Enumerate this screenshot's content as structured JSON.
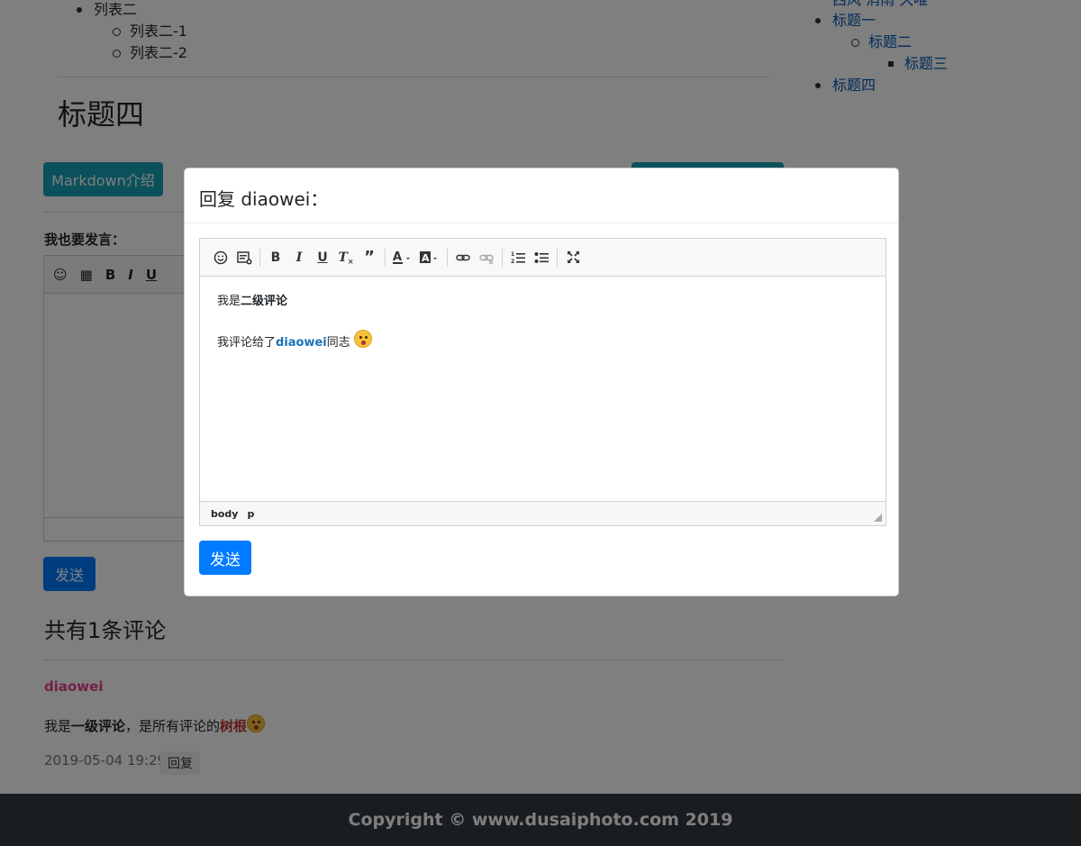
{
  "content_list": {
    "item2": "列表二",
    "sub1": "列表二-1",
    "sub2": "列表二-2"
  },
  "heading": "标题四",
  "toc": {
    "top": "西风 消雨 久唯",
    "item1": "标题一",
    "item2": "标题二",
    "item3": "标题三",
    "item4": "标题四"
  },
  "markdown_button": "Markdown介绍",
  "comment_form": {
    "label": "我也要发言：",
    "send_label": "发送"
  },
  "comments": {
    "title": "共有1条评论",
    "author": "diaowei",
    "body_prefix": "我是",
    "body_bold": "一级评论",
    "body_middle": "，是所有评论的",
    "body_highlight": "树根",
    "time": "2019-05-04 19:29",
    "reply_label": "回复"
  },
  "footer": "Copyright © www.dusaiphoto.com 2019",
  "modal": {
    "title": "回复 diaowei：",
    "line1_prefix": "我是",
    "line1_bold": "二级评论",
    "line2_prefix": "我评论给了",
    "line2_link": "diaowei",
    "line2_suffix": "同志",
    "status_body": "body",
    "status_p": "p",
    "send_label": "发送",
    "toolbar_icons": [
      "smiley-icon",
      "code-snippet-icon",
      "bold-icon",
      "italic-icon",
      "underline-icon",
      "remove-format-icon",
      "blockquote-icon",
      "text-color-icon",
      "background-color-icon",
      "link-icon",
      "unlink-icon",
      "numbered-list-icon",
      "bulleted-list-icon",
      "maximize-icon"
    ]
  },
  "colors": {
    "primary": "#007bff",
    "info": "#17a2b8",
    "author": "#e83e8c",
    "footer_bg": "#343a40"
  }
}
